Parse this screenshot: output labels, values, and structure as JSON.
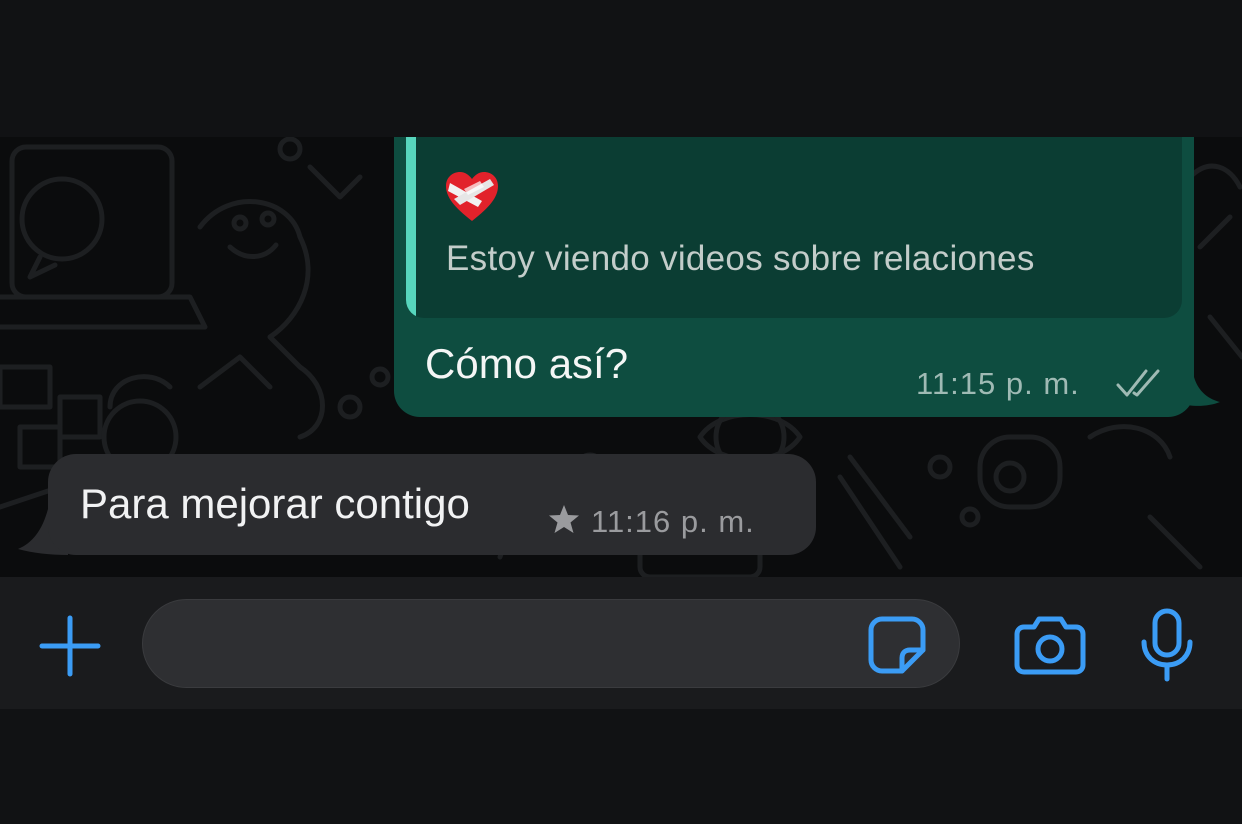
{
  "conversation": {
    "quoted_message": {
      "emoji": "❤️‍🩹",
      "text": "Estoy viendo videos sobre relaciones"
    },
    "outgoing": {
      "text": "Cómo así?",
      "time": "11:15 p. m.",
      "status": "read"
    },
    "incoming": {
      "text": "Para mejorar contigo",
      "time": "11:16 p. m.",
      "starred": true
    }
  },
  "input_bar": {
    "message_value": "",
    "placeholder": ""
  },
  "icons": {
    "add": "plus-icon",
    "sticker": "sticker-icon",
    "camera": "camera-icon",
    "microphone": "microphone-icon",
    "read_receipt": "double-check-icon",
    "starred": "star-icon"
  },
  "colors": {
    "accent": "#3b9cf5",
    "outgoing_bubble": "#0e4d40",
    "quote_bar": "#57d6bd",
    "incoming_bubble": "#2b2c2f",
    "chat_background": "#0b0c0d"
  }
}
